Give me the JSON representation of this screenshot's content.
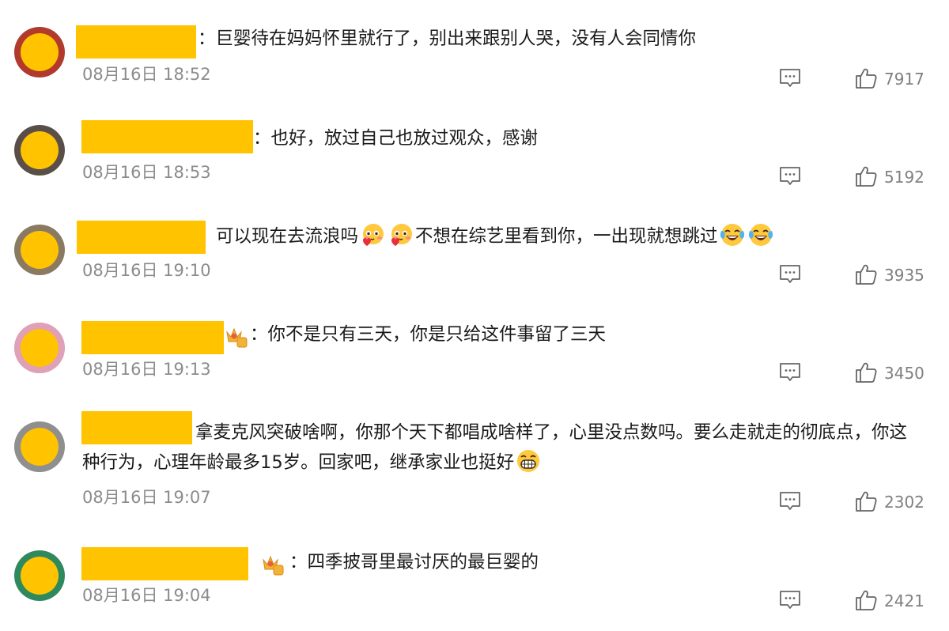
{
  "comments": [
    {
      "prefix": "：",
      "text": "巨婴待在妈妈怀里就行了，别出来跟别人哭，没有人会同情你",
      "time": "08月16日 18:52",
      "likes": "7917",
      "avatar_color": "#b23a2c"
    },
    {
      "prefix": "：",
      "text": "也好，放过自己也放过观众，感谢",
      "time": "08月16日 18:53",
      "likes": "5192",
      "avatar_color": "#5a4e48"
    },
    {
      "prefix": "",
      "text_parts": [
        "可以现在去流浪吗",
        "不想在综艺里看到你，一出现就想跳过"
      ],
      "time": "08月16日 19:10",
      "likes": "3935",
      "avatar_color": "#8a7a62"
    },
    {
      "prefix": "：",
      "text": "你不是只有三天，你是只给这件事留了三天",
      "time": "08月16日 19:13",
      "likes": "3450",
      "avatar_color": "#e0a0b8",
      "badge_level": "2"
    },
    {
      "prefix": "",
      "text_line1": "拿麦克风突破啥啊，你那个天下都唱成啥样了，心里没点数吗。要么走就走的彻底点，你这",
      "text_line2": "种行为，心理年龄最多15岁。回家吧，继承家业也挺好",
      "time": "08月16日 19:07",
      "likes": "2302",
      "avatar_color": "#8f8f8f"
    },
    {
      "prefix": "：",
      "text": "四季披哥里最讨厌的最巨婴的",
      "time": "08月16日 19:04",
      "likes": "2421",
      "avatar_color": "#2e8a5e",
      "badge_level": "6"
    }
  ],
  "colors": {
    "redaction": "#FFC300",
    "time_text": "#8c8c8c",
    "count_text": "#808080",
    "icon_stroke": "#666666"
  },
  "icons": {
    "reply": "comment-bubble-icon",
    "like": "thumbs-up-icon",
    "emoji_blush": "blushing-heart-emoji",
    "emoji_cry_laugh": "laughing-tears-emoji",
    "emoji_grin": "grinning-emoji",
    "badge": "crown-badge-icon"
  }
}
